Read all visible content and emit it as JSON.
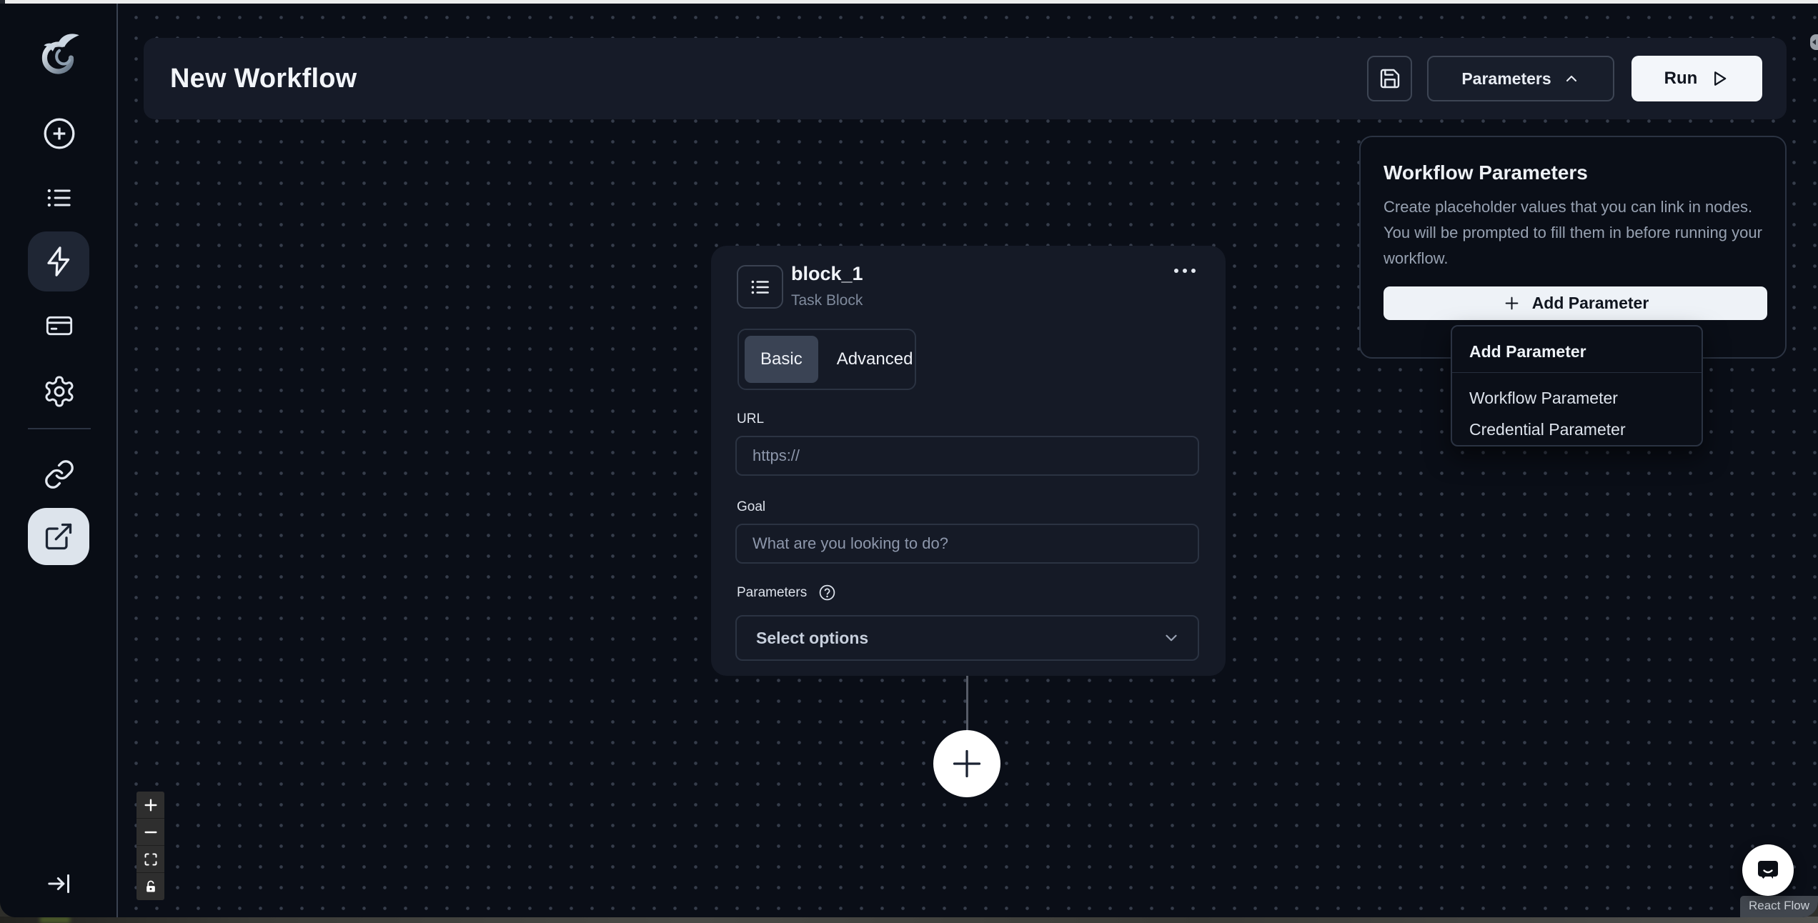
{
  "header": {
    "title": "New Workflow",
    "parameters_button": "Parameters",
    "run_button": "Run"
  },
  "sidebar": {
    "icons": [
      "skyvern-logo",
      "create-new",
      "runs-list",
      "workflows",
      "billing",
      "settings",
      "integrations",
      "browser-session",
      "expand-sidebar"
    ],
    "active_icons": [
      "workflows",
      "browser-session"
    ]
  },
  "block": {
    "name": "block_1",
    "type_label": "Task Block",
    "tabs": {
      "basic": "Basic",
      "advanced": "Advanced"
    },
    "active_tab": "Basic",
    "url_label": "URL",
    "url_placeholder": "https://",
    "goal_label": "Goal",
    "goal_placeholder": "What are you looking to do?",
    "parameters_label": "Parameters",
    "parameters_select_placeholder": "Select options"
  },
  "parameters_panel": {
    "title": "Workflow Parameters",
    "description": "Create placeholder values that you can link in nodes. You will be prompted to fill them in before running your workflow.",
    "add_button": "Add Parameter"
  },
  "add_parameter_menu": {
    "header": "Add Parameter",
    "items": [
      "Workflow Parameter",
      "Credential Parameter"
    ]
  },
  "canvas": {
    "attribution": "React Flow"
  },
  "colors": {
    "canvas_bg": "#0a0e17",
    "surface": "#161b28",
    "panel_border": "#2b3342",
    "accent_light": "#eef2f7",
    "active_nav_light": "#dde4ec",
    "active_nav_dark": "#1f2634"
  }
}
